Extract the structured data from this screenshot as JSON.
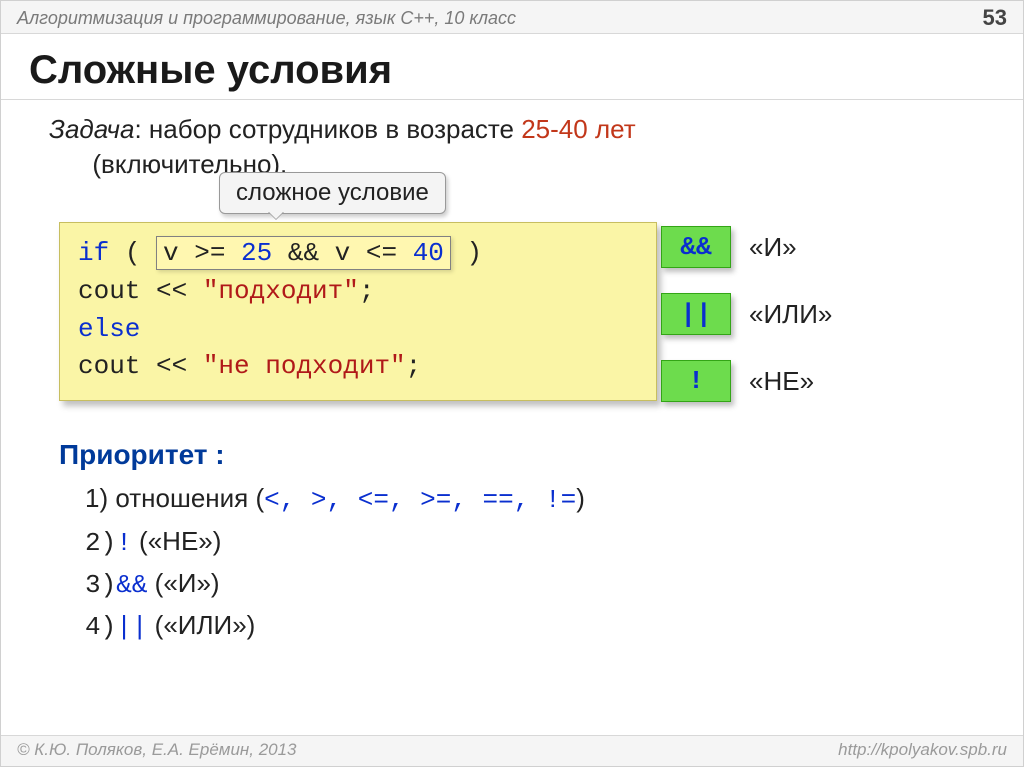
{
  "header": {
    "course": "Алгоритмизация и программирование, язык  C++, 10 класс",
    "page": "53"
  },
  "title": "Сложные условия",
  "task": {
    "label": "Задача",
    "text_before": ": набор сотрудников в возрасте ",
    "range": "25-40 лет",
    "text_after_line2": "(включительно)."
  },
  "callout": "сложное условие",
  "code": {
    "if": "if",
    "open": " ( ",
    "cond": "v >= 25 && v <= 40",
    "num1": "25",
    "num2": "40",
    "close": " )",
    "cout1a": "  cout << ",
    "str1": "\"подходит\"",
    "semi1": ";",
    "else": "else",
    "cout2a": "  cout << ",
    "str2": "\"не подходит\"",
    "semi2": ";"
  },
  "operators": [
    {
      "chip": "&&",
      "label": "«И»"
    },
    {
      "chip": "||",
      "label": "«ИЛИ»"
    },
    {
      "chip": "!",
      "label": "«НЕ»"
    }
  ],
  "priority": {
    "head": "Приоритет :",
    "items": [
      {
        "n": "1)",
        "plain_before": " отношения (",
        "ops": "<, >, <=, >=, ==, !=",
        "plain_after": ")"
      },
      {
        "n": "2)",
        "op": "!",
        "plain": " («НЕ»)"
      },
      {
        "n": "3)",
        "op": "&&",
        "plain": " («И»)"
      },
      {
        "n": "4)",
        "op": "||",
        "plain": " («ИЛИ»)"
      }
    ]
  },
  "footer": {
    "copyright": "© К.Ю. Поляков, Е.А. Ерёмин, 2013",
    "url": "http://kpolyakov.spb.ru"
  }
}
